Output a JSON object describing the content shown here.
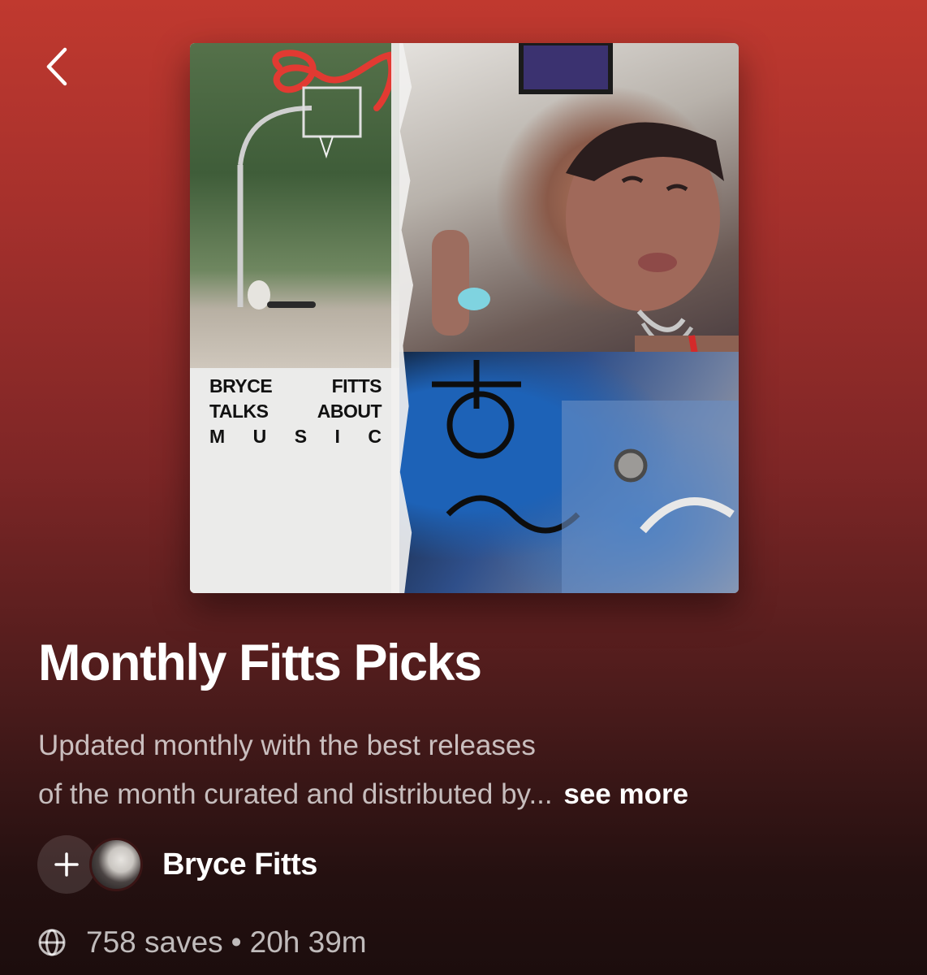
{
  "header": {
    "back_icon": "chevron-left-icon"
  },
  "cover": {
    "poster_text": {
      "row1_left": "BRYCE",
      "row1_right": "FITTS",
      "row2_left": "TALKS",
      "row2_right": "ABOUT",
      "row3_letters": [
        "M",
        "U",
        "S",
        "I",
        "C"
      ]
    }
  },
  "playlist": {
    "title": "Monthly Fitts Picks",
    "description_line1": "Updated monthly with the best releases",
    "description_line2": "of the month curated and distributed by...",
    "see_more_label": "see more"
  },
  "owner": {
    "add_icon": "plus-icon",
    "name": "Bryce Fitts"
  },
  "meta": {
    "visibility_icon": "globe-icon",
    "saves": "758 saves",
    "separator": "•",
    "duration": "20h 39m"
  },
  "colors": {
    "background_top": "#c0392f",
    "background_bottom": "#1c0d0d",
    "text_primary": "#ffffff",
    "text_secondary": "rgba(255,255,255,0.72)"
  }
}
